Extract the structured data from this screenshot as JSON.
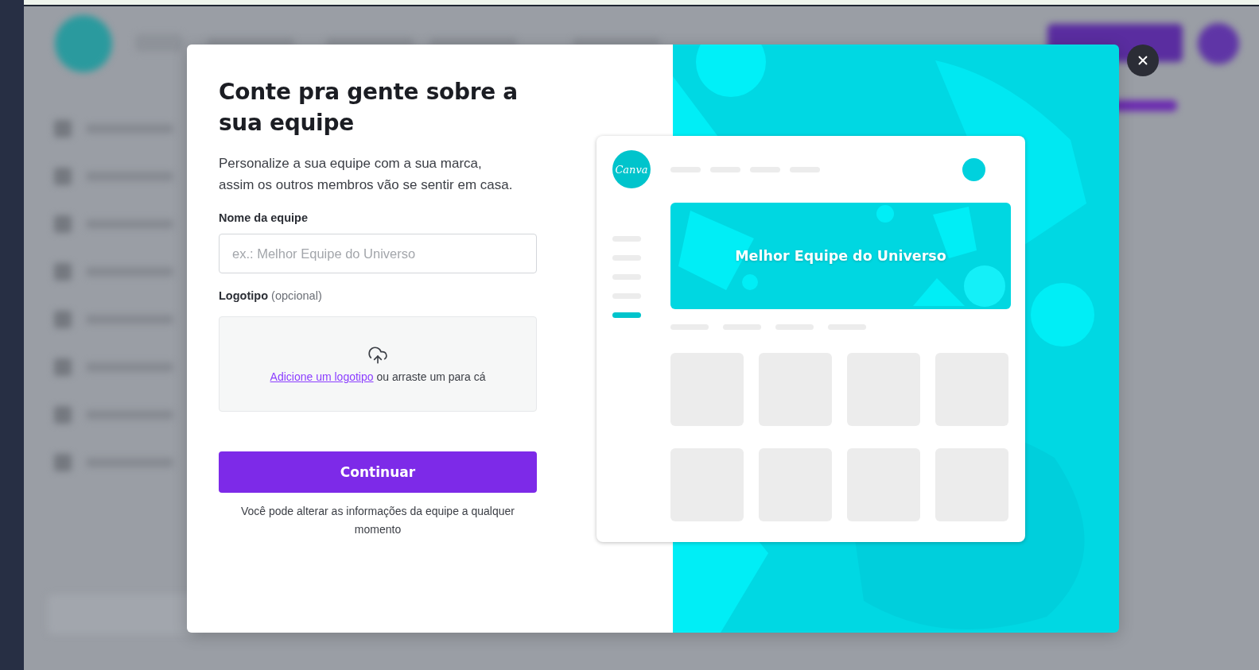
{
  "dialog": {
    "title": "Conte pra gente sobre a sua equipe",
    "description": "Personalize a sua equipe com a sua marca, assim os outros membros vão se sentir em casa.",
    "name_field": {
      "label": "Nome da equipe",
      "placeholder": "ex.: Melhor Equipe do Universo"
    },
    "logo_field": {
      "label": "Logotipo",
      "optional": "(opcional)",
      "link": "Adicione um logotipo",
      "hint": "ou arraste um para cá"
    },
    "button": "Continuar",
    "footnote": "Você pode alterar as informações da equipe a qualquer momento"
  },
  "preview": {
    "logo": "Canva",
    "banner_title": "Melhor Equipe do Universo"
  }
}
